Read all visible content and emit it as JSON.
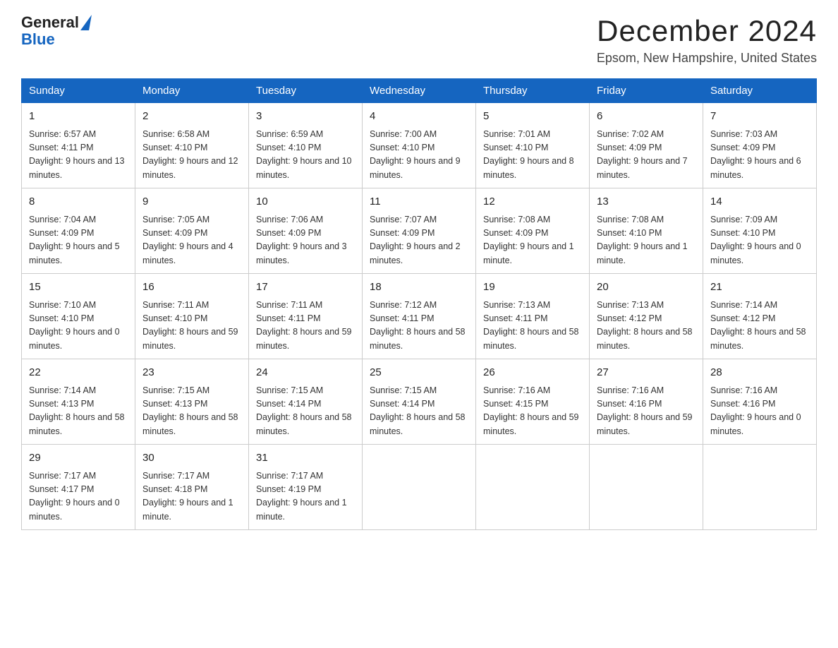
{
  "header": {
    "logo": {
      "general": "General",
      "arrow": "▶",
      "blue": "Blue"
    },
    "title": "December 2024",
    "location": "Epsom, New Hampshire, United States"
  },
  "calendar": {
    "days_of_week": [
      "Sunday",
      "Monday",
      "Tuesday",
      "Wednesday",
      "Thursday",
      "Friday",
      "Saturday"
    ],
    "weeks": [
      [
        {
          "day": "1",
          "sunrise": "6:57 AM",
          "sunset": "4:11 PM",
          "daylight": "9 hours and 13 minutes."
        },
        {
          "day": "2",
          "sunrise": "6:58 AM",
          "sunset": "4:10 PM",
          "daylight": "9 hours and 12 minutes."
        },
        {
          "day": "3",
          "sunrise": "6:59 AM",
          "sunset": "4:10 PM",
          "daylight": "9 hours and 10 minutes."
        },
        {
          "day": "4",
          "sunrise": "7:00 AM",
          "sunset": "4:10 PM",
          "daylight": "9 hours and 9 minutes."
        },
        {
          "day": "5",
          "sunrise": "7:01 AM",
          "sunset": "4:10 PM",
          "daylight": "9 hours and 8 minutes."
        },
        {
          "day": "6",
          "sunrise": "7:02 AM",
          "sunset": "4:09 PM",
          "daylight": "9 hours and 7 minutes."
        },
        {
          "day": "7",
          "sunrise": "7:03 AM",
          "sunset": "4:09 PM",
          "daylight": "9 hours and 6 minutes."
        }
      ],
      [
        {
          "day": "8",
          "sunrise": "7:04 AM",
          "sunset": "4:09 PM",
          "daylight": "9 hours and 5 minutes."
        },
        {
          "day": "9",
          "sunrise": "7:05 AM",
          "sunset": "4:09 PM",
          "daylight": "9 hours and 4 minutes."
        },
        {
          "day": "10",
          "sunrise": "7:06 AM",
          "sunset": "4:09 PM",
          "daylight": "9 hours and 3 minutes."
        },
        {
          "day": "11",
          "sunrise": "7:07 AM",
          "sunset": "4:09 PM",
          "daylight": "9 hours and 2 minutes."
        },
        {
          "day": "12",
          "sunrise": "7:08 AM",
          "sunset": "4:09 PM",
          "daylight": "9 hours and 1 minute."
        },
        {
          "day": "13",
          "sunrise": "7:08 AM",
          "sunset": "4:10 PM",
          "daylight": "9 hours and 1 minute."
        },
        {
          "day": "14",
          "sunrise": "7:09 AM",
          "sunset": "4:10 PM",
          "daylight": "9 hours and 0 minutes."
        }
      ],
      [
        {
          "day": "15",
          "sunrise": "7:10 AM",
          "sunset": "4:10 PM",
          "daylight": "9 hours and 0 minutes."
        },
        {
          "day": "16",
          "sunrise": "7:11 AM",
          "sunset": "4:10 PM",
          "daylight": "8 hours and 59 minutes."
        },
        {
          "day": "17",
          "sunrise": "7:11 AM",
          "sunset": "4:11 PM",
          "daylight": "8 hours and 59 minutes."
        },
        {
          "day": "18",
          "sunrise": "7:12 AM",
          "sunset": "4:11 PM",
          "daylight": "8 hours and 58 minutes."
        },
        {
          "day": "19",
          "sunrise": "7:13 AM",
          "sunset": "4:11 PM",
          "daylight": "8 hours and 58 minutes."
        },
        {
          "day": "20",
          "sunrise": "7:13 AM",
          "sunset": "4:12 PM",
          "daylight": "8 hours and 58 minutes."
        },
        {
          "day": "21",
          "sunrise": "7:14 AM",
          "sunset": "4:12 PM",
          "daylight": "8 hours and 58 minutes."
        }
      ],
      [
        {
          "day": "22",
          "sunrise": "7:14 AM",
          "sunset": "4:13 PM",
          "daylight": "8 hours and 58 minutes."
        },
        {
          "day": "23",
          "sunrise": "7:15 AM",
          "sunset": "4:13 PM",
          "daylight": "8 hours and 58 minutes."
        },
        {
          "day": "24",
          "sunrise": "7:15 AM",
          "sunset": "4:14 PM",
          "daylight": "8 hours and 58 minutes."
        },
        {
          "day": "25",
          "sunrise": "7:15 AM",
          "sunset": "4:14 PM",
          "daylight": "8 hours and 58 minutes."
        },
        {
          "day": "26",
          "sunrise": "7:16 AM",
          "sunset": "4:15 PM",
          "daylight": "8 hours and 59 minutes."
        },
        {
          "day": "27",
          "sunrise": "7:16 AM",
          "sunset": "4:16 PM",
          "daylight": "8 hours and 59 minutes."
        },
        {
          "day": "28",
          "sunrise": "7:16 AM",
          "sunset": "4:16 PM",
          "daylight": "9 hours and 0 minutes."
        }
      ],
      [
        {
          "day": "29",
          "sunrise": "7:17 AM",
          "sunset": "4:17 PM",
          "daylight": "9 hours and 0 minutes."
        },
        {
          "day": "30",
          "sunrise": "7:17 AM",
          "sunset": "4:18 PM",
          "daylight": "9 hours and 1 minute."
        },
        {
          "day": "31",
          "sunrise": "7:17 AM",
          "sunset": "4:19 PM",
          "daylight": "9 hours and 1 minute."
        },
        null,
        null,
        null,
        null
      ]
    ]
  }
}
